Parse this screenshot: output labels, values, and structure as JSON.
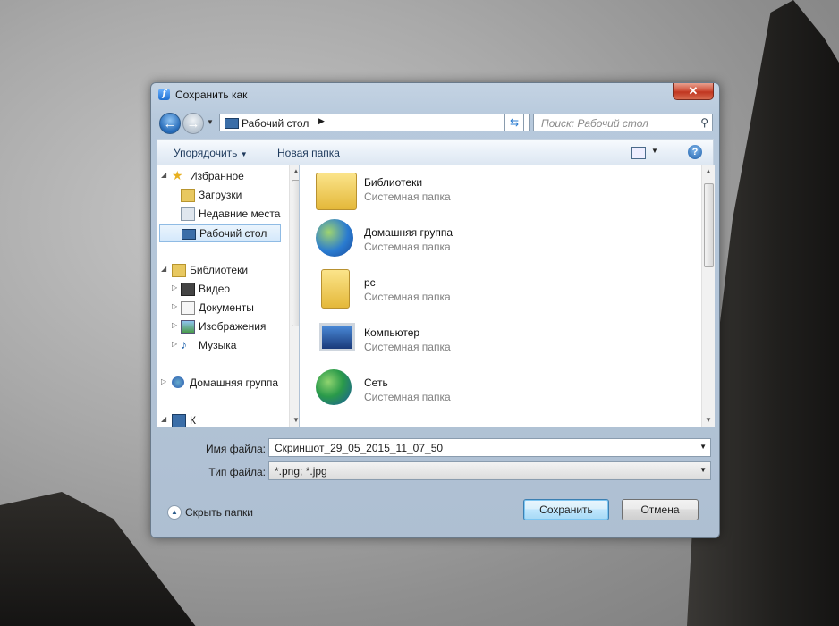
{
  "dialog": {
    "title": "Сохранить как",
    "close_label": "✕"
  },
  "nav": {
    "address": "Рабочий стол",
    "search_placeholder": "Поиск: Рабочий стол"
  },
  "toolbar": {
    "organize": "Упорядочить",
    "new_folder": "Новая папка",
    "help": "?"
  },
  "sidebar": {
    "items": [
      {
        "label": "Избранное",
        "icon": "star-icon"
      },
      {
        "label": "Загрузки",
        "icon": "downloads-icon"
      },
      {
        "label": "Недавние места",
        "icon": "recent-places-icon"
      },
      {
        "label": "Рабочий стол",
        "icon": "desktop-icon",
        "selected": true
      },
      {
        "label": "Библиотеки",
        "icon": "libraries-icon"
      },
      {
        "label": "Видео",
        "icon": "video-icon"
      },
      {
        "label": "Документы",
        "icon": "documents-icon"
      },
      {
        "label": "Изображения",
        "icon": "pictures-icon"
      },
      {
        "label": "Музыка",
        "icon": "music-icon"
      },
      {
        "label": "Домашняя группа",
        "icon": "homegroup-icon"
      },
      {
        "label": "К",
        "icon": "computer-icon"
      }
    ]
  },
  "files": [
    {
      "name": "Библиотеки",
      "desc": "Системная папка",
      "icon": "libraries-icon"
    },
    {
      "name": "Домашняя группа",
      "desc": "Системная папка",
      "icon": "homegroup-icon"
    },
    {
      "name": "pc",
      "desc": "Системная папка",
      "icon": "user-folder-icon"
    },
    {
      "name": "Компьютер",
      "desc": "Системная папка",
      "icon": "computer-icon"
    },
    {
      "name": "Сеть",
      "desc": "Системная папка",
      "icon": "network-icon"
    }
  ],
  "form": {
    "filename_label": "Имя файла:",
    "filename_value": "Скриншот_29_05_2015_11_07_50",
    "filetype_label": "Тип файла:",
    "filetype_value": "*.png; *.jpg"
  },
  "footer": {
    "hide_folders": "Скрыть папки",
    "save": "Сохранить",
    "cancel": "Отмена"
  }
}
